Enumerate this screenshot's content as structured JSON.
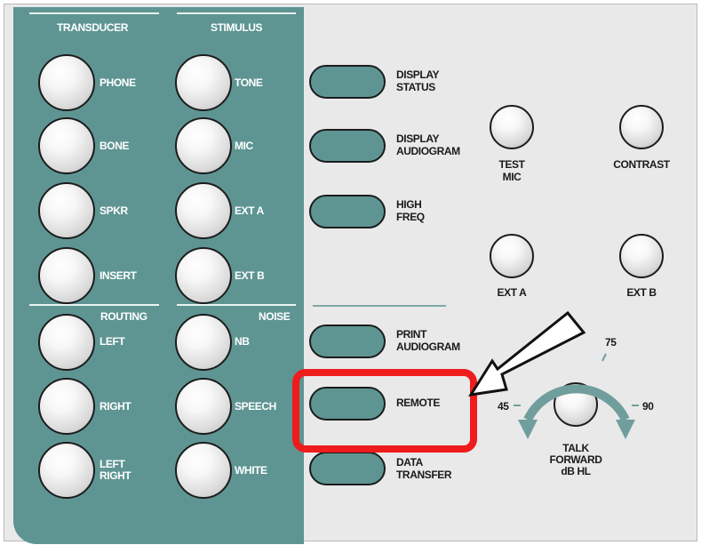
{
  "sections": {
    "transducer": "TRANSDUCER",
    "stimulus": "STIMULUS",
    "routing": "ROUTING",
    "noise": "NOISE"
  },
  "transducer_buttons": [
    "PHONE",
    "BONE",
    "SPKR",
    "INSERT"
  ],
  "stimulus_buttons": [
    "TONE",
    "MIC",
    "EXT A",
    "EXT B"
  ],
  "routing_buttons": [
    "LEFT",
    "RIGHT",
    "LEFT\nRIGHT"
  ],
  "noise_buttons": [
    "NB",
    "SPEECH",
    "WHITE"
  ],
  "display_buttons": [
    "DISPLAY\nSTATUS",
    "DISPLAY\nAUDIOGRAM",
    "HIGH\nFREQ"
  ],
  "lower_buttons": [
    "PRINT\nAUDIOGRAM",
    "REMOTE",
    "DATA\nTRANSFER"
  ],
  "knobs": {
    "test_mic": "TEST\nMIC",
    "contrast": "CONTRAST",
    "ext_a": "EXT A",
    "ext_b": "EXT B"
  },
  "talk_forward": {
    "label": "TALK\nFORWARD\ndB HL",
    "scale_min": "45",
    "scale_mid": "75",
    "scale_max": "90"
  },
  "colors": {
    "panel": "#e9e9e9",
    "teal": "#5e9593",
    "dial_arc": "#6f9e9c",
    "highlight": "#ee1c1c",
    "arrow_fill": "#ffffff"
  },
  "annotation": {
    "highlighted_control": "REMOTE",
    "arrow_icon": "pointer-arrow-icon"
  }
}
